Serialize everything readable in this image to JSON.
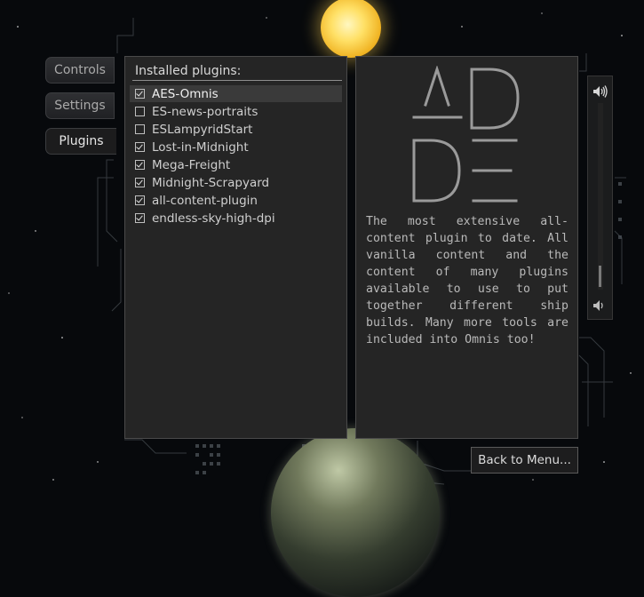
{
  "tabs": [
    {
      "label": "Controls"
    },
    {
      "label": "Settings"
    },
    {
      "label": "Plugins",
      "active": true
    }
  ],
  "plugins": {
    "title": "Installed plugins:",
    "items": [
      {
        "name": "AES-Omnis",
        "enabled": true,
        "selected": true
      },
      {
        "name": "ES-news-portraits",
        "enabled": false
      },
      {
        "name": "ESLampyridStart",
        "enabled": false
      },
      {
        "name": "Lost-in-Midnight",
        "enabled": true
      },
      {
        "name": "Mega-Freight",
        "enabled": true
      },
      {
        "name": "Midnight-Scrapyard",
        "enabled": true
      },
      {
        "name": "all-content-plugin",
        "enabled": true
      },
      {
        "name": "endless-sky-high-dpi",
        "enabled": true
      }
    ]
  },
  "description": {
    "logo_text": "ADDE",
    "text": "The most extensive all-content plugin to date. All vanilla content and the content of many plugins available to use to put together different ship builds. Many more tools are included into Omnis too!"
  },
  "volume": {
    "level": 0.1,
    "high_icon": "speaker-high-icon",
    "low_icon": "speaker-low-icon"
  },
  "back_button": {
    "label": "Back to Menu..."
  },
  "colors": {
    "panel": "#252525",
    "selected_row": "#3a3a3a",
    "background": "#07090c"
  }
}
